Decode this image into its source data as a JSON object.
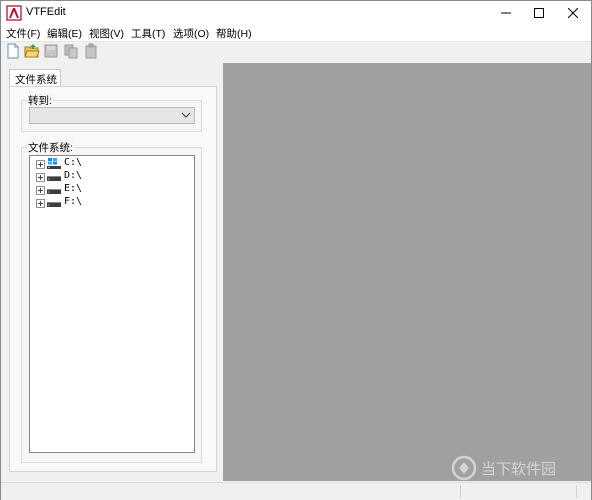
{
  "window": {
    "title": "VTFEdit",
    "controls": {
      "minimize": "minimize-icon",
      "maximize": "maximize-icon",
      "close": "close-icon"
    }
  },
  "menu": [
    "文件(F)",
    "编辑(E)",
    "视图(V)",
    "工具(T)",
    "选项(O)",
    "帮助(H)"
  ],
  "toolbar": {
    "buttons": [
      "new-file-icon",
      "open-folder-icon",
      "save-icon",
      "copy-icon",
      "paste-icon"
    ]
  },
  "left_panel": {
    "tab_label": "文件系统",
    "goto_group_label": "转到:",
    "goto_selected": "",
    "filesystem_group_label": "文件系统:",
    "drives": [
      "C:\\",
      "D:\\",
      "E:\\",
      "F:\\"
    ]
  },
  "watermark": {
    "text": "当下软件园"
  },
  "colors": {
    "viewport": "#a0a0a0",
    "window_bg": "#f0f0f0"
  }
}
